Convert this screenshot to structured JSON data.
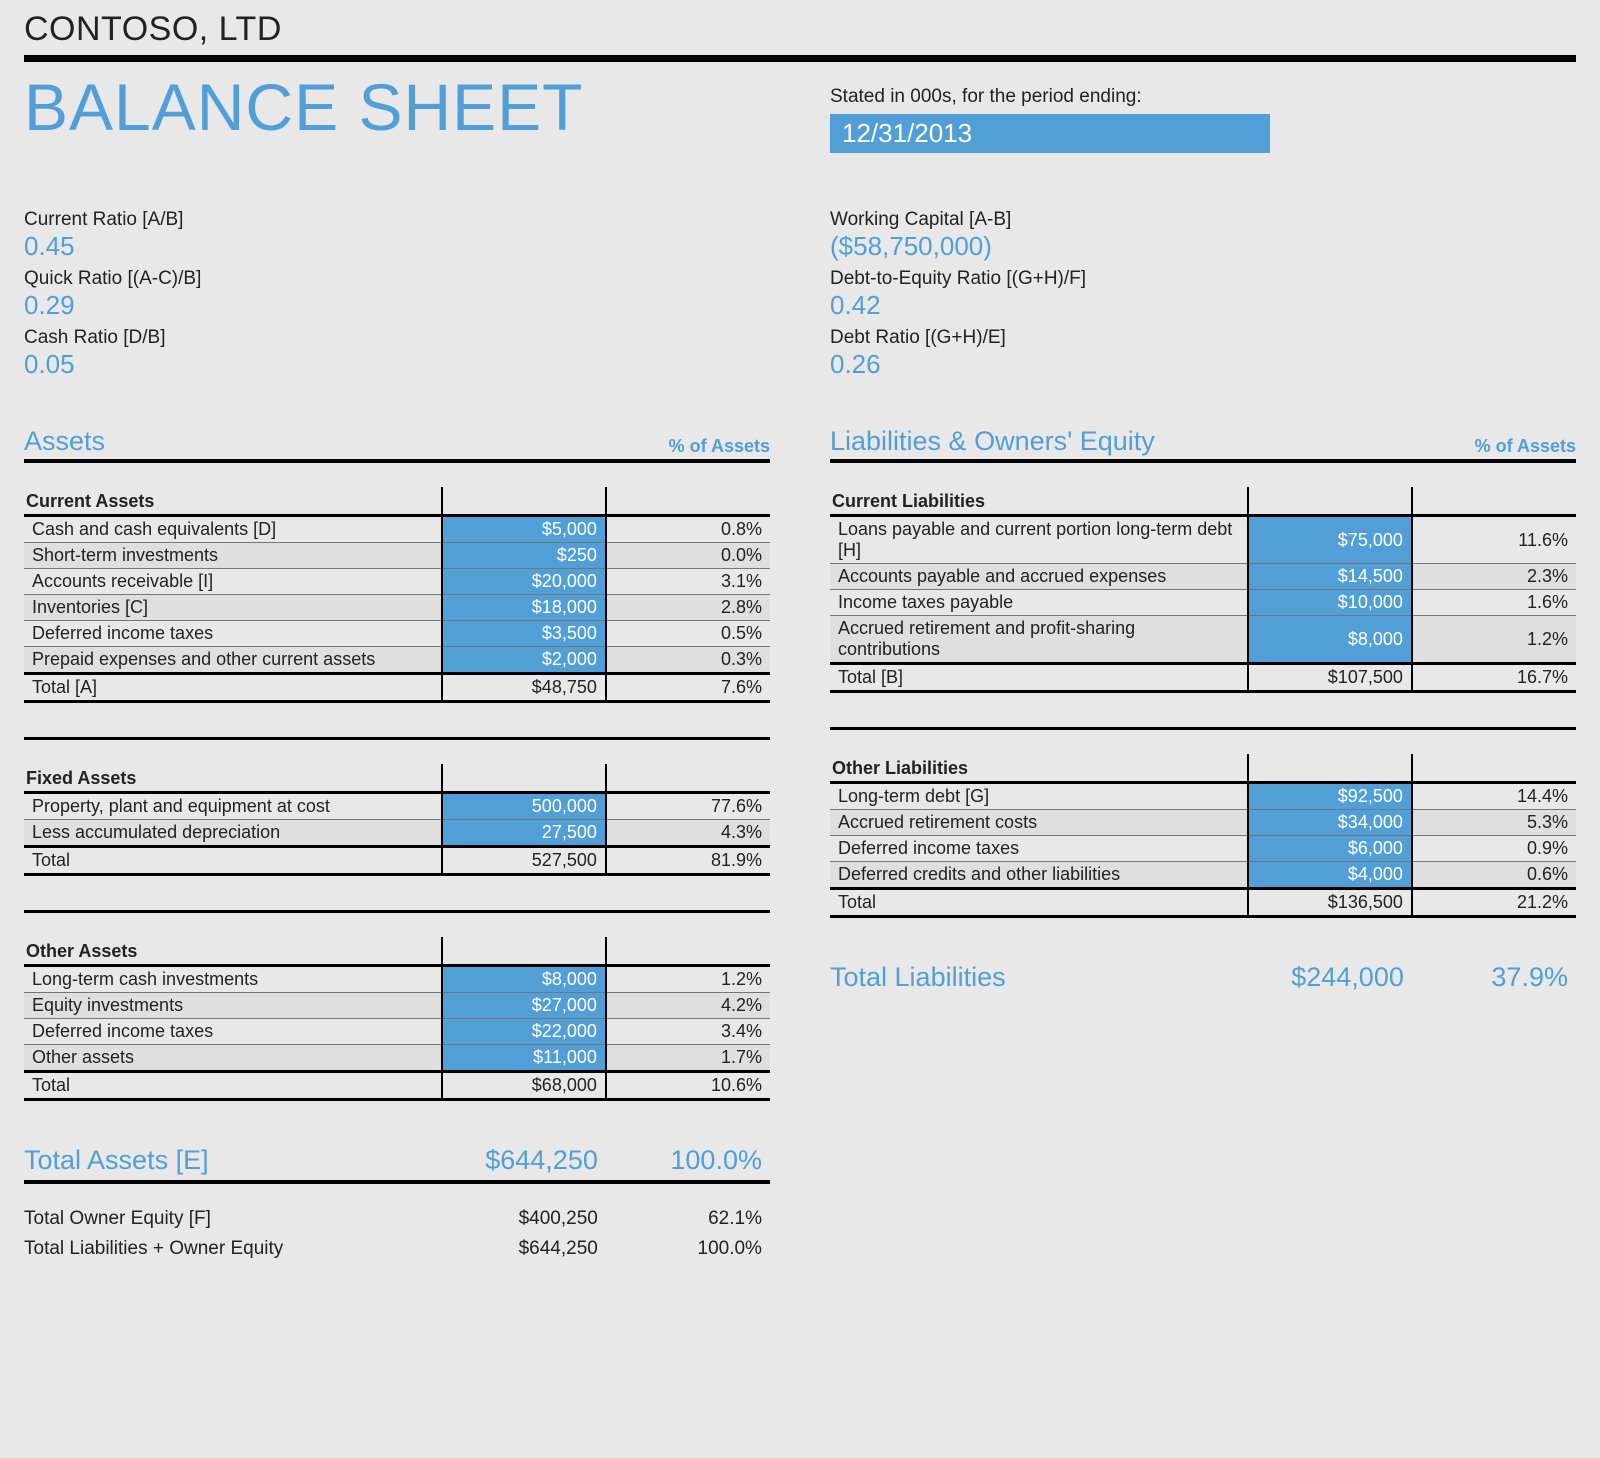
{
  "company": "CONTOSO, LTD",
  "title": "BALANCE SHEET",
  "stated_label": "Stated in 000s, for the period ending:",
  "period_date": "12/31/2013",
  "ratios_left": [
    {
      "label": "Current Ratio   [A/B]",
      "value": "0.45"
    },
    {
      "label": "Quick Ratio   [(A-C)/B]",
      "value": "0.29"
    },
    {
      "label": "Cash Ratio   [D/B]",
      "value": "0.05"
    }
  ],
  "ratios_right": [
    {
      "label": "Working Capital   [A-B]",
      "value": "($58,750,000)"
    },
    {
      "label": "Debt-to-Equity Ratio   [(G+H)/F]",
      "value": "0.42"
    },
    {
      "label": "Debt Ratio   [(G+H)/E]",
      "value": "0.26"
    }
  ],
  "assets_header": "Assets",
  "liab_header": "Liabilities & Owners' Equity",
  "pct_header": "% of Assets",
  "assets": {
    "groups": [
      {
        "title": "Current Assets",
        "rows": [
          {
            "label": "Cash and cash equivalents   [D]",
            "amount": "$5,000",
            "pct": "0.8%"
          },
          {
            "label": "Short-term investments",
            "amount": "$250",
            "pct": "0.0%"
          },
          {
            "label": "Accounts receivable   [I]",
            "amount": "$20,000",
            "pct": "3.1%"
          },
          {
            "label": "Inventories   [C]",
            "amount": "$18,000",
            "pct": "2.8%"
          },
          {
            "label": "Deferred income taxes",
            "amount": "$3,500",
            "pct": "0.5%"
          },
          {
            "label": "Prepaid expenses and other current assets",
            "amount": "$2,000",
            "pct": "0.3%"
          }
        ],
        "total": {
          "label": "Total   [A]",
          "amount": "$48,750",
          "pct": "7.6%"
        }
      },
      {
        "title": "Fixed Assets",
        "rows": [
          {
            "label": "Property, plant and equipment at cost",
            "amount": "500,000",
            "pct": "77.6%"
          },
          {
            "label": "Less accumulated depreciation",
            "amount": "27,500",
            "pct": "4.3%"
          }
        ],
        "total": {
          "label": "Total",
          "amount": "527,500",
          "pct": "81.9%"
        }
      },
      {
        "title": "Other Assets",
        "rows": [
          {
            "label": "Long-term cash investments",
            "amount": "$8,000",
            "pct": "1.2%"
          },
          {
            "label": "Equity investments",
            "amount": "$27,000",
            "pct": "4.2%"
          },
          {
            "label": "Deferred income taxes",
            "amount": "$22,000",
            "pct": "3.4%"
          },
          {
            "label": "Other assets",
            "amount": "$11,000",
            "pct": "1.7%"
          }
        ],
        "total": {
          "label": "Total",
          "amount": "$68,000",
          "pct": "10.6%"
        }
      }
    ],
    "grand_total": {
      "label": "Total Assets   [E]",
      "amount": "$644,250",
      "pct": "100.0%"
    },
    "footer": [
      {
        "label": "Total Owner Equity   [F]",
        "amount": "$400,250",
        "pct": "62.1%"
      },
      {
        "label": "Total Liabilities + Owner Equity",
        "amount": "$644,250",
        "pct": "100.0%"
      }
    ]
  },
  "liabilities": {
    "groups": [
      {
        "title": "Current Liabilities",
        "rows": [
          {
            "label": "Loans payable and current portion long-term debt   [H]",
            "amount": "$75,000",
            "pct": "11.6%"
          },
          {
            "label": "Accounts payable and accrued expenses",
            "amount": "$14,500",
            "pct": "2.3%"
          },
          {
            "label": "Income taxes payable",
            "amount": "$10,000",
            "pct": "1.6%"
          },
          {
            "label": "Accrued retirement and profit-sharing contributions",
            "amount": "$8,000",
            "pct": "1.2%"
          }
        ],
        "total": {
          "label": "Total   [B]",
          "amount": "$107,500",
          "pct": "16.7%"
        }
      },
      {
        "title": "Other Liabilities",
        "rows": [
          {
            "label": "Long-term debt   [G]",
            "amount": "$92,500",
            "pct": "14.4%"
          },
          {
            "label": "Accrued retirement costs",
            "amount": "$34,000",
            "pct": "5.3%"
          },
          {
            "label": "Deferred income taxes",
            "amount": "$6,000",
            "pct": "0.9%"
          },
          {
            "label": "Deferred credits and other liabilities",
            "amount": "$4,000",
            "pct": "0.6%"
          }
        ],
        "total": {
          "label": "Total",
          "amount": "$136,500",
          "pct": "21.2%"
        }
      }
    ],
    "grand_total": {
      "label": "Total Liabilities",
      "amount": "$244,000",
      "pct": "37.9%"
    }
  }
}
